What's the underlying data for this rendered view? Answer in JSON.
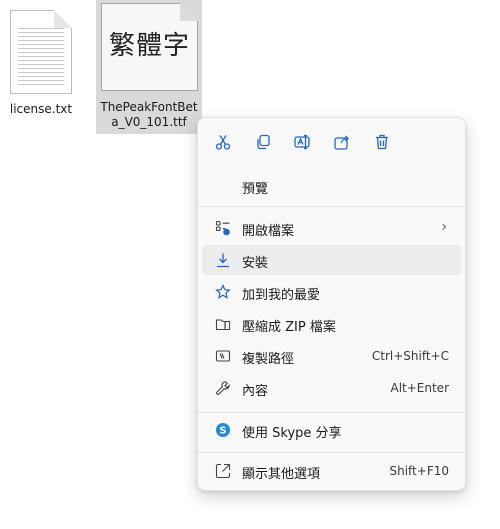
{
  "files": [
    {
      "name_line1": "license.txt",
      "name_line2": ""
    },
    {
      "name_line1": "ThePeakFontBet",
      "name_line2": "a_V0_101.ttf",
      "preview_text": "繁體字",
      "selected": true
    }
  ],
  "quick_actions": [
    {
      "icon": "cut-icon"
    },
    {
      "icon": "copy-icon"
    },
    {
      "icon": "rename-icon"
    },
    {
      "icon": "share-icon"
    },
    {
      "icon": "delete-icon"
    }
  ],
  "menu": {
    "preview": "預覽",
    "open_with": "開啟檔案",
    "install": "安裝",
    "add_favorites": "加到我的最愛",
    "compress_zip": "壓縮成 ZIP 檔案",
    "copy_path": "複製路徑",
    "copy_path_shortcut": "Ctrl+Shift+C",
    "properties": "內容",
    "properties_shortcut": "Alt+Enter",
    "share_skype": "使用 Skype 分享",
    "more_options": "顯示其他選項",
    "more_options_shortcut": "Shift+F10"
  },
  "colors": {
    "accent": "#1e66c9",
    "skype": "#1e88e5",
    "menu_bg": "#f9f9f9",
    "highlight": "#ececec",
    "selection": "#d9d9d9"
  }
}
